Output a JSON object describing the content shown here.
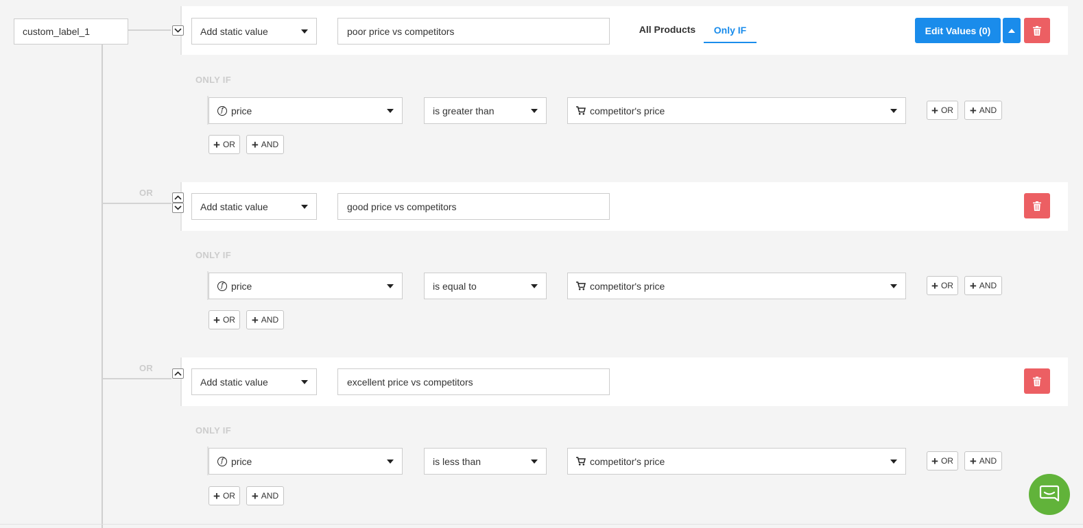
{
  "label": {
    "name": "custom_label_1"
  },
  "rules": [
    {
      "source": "Add static value",
      "value": "poor price vs competitors",
      "only_if": "ONLY IF",
      "condition": {
        "field": "price",
        "operator": "is greater than",
        "compare": "competitor's price"
      }
    },
    {
      "source": "Add static value",
      "value": "good price vs competitors",
      "only_if": "ONLY IF",
      "condition": {
        "field": "price",
        "operator": "is equal to",
        "compare": "competitor's price"
      }
    },
    {
      "source": "Add static value",
      "value": "excellent price vs competitors",
      "only_if": "ONLY IF",
      "condition": {
        "field": "price",
        "operator": "is less than",
        "compare": "competitor's price"
      }
    }
  ],
  "tabs": {
    "all_products": "All Products",
    "only_if": "Only IF",
    "active": "only_if"
  },
  "buttons": {
    "edit_values": "Edit Values (0)",
    "or": "OR",
    "and": "AND"
  },
  "connectors": {
    "or": "OR"
  },
  "colors": {
    "accent": "#1a8ceb",
    "danger": "#ec5f63",
    "chat": "#61b33a",
    "background": "#f4f4f4"
  },
  "icons": [
    "function-icon",
    "cart-icon",
    "chevron-down-icon",
    "chevron-up-icon",
    "caret-up-icon",
    "trash-icon",
    "chat-icon"
  ]
}
